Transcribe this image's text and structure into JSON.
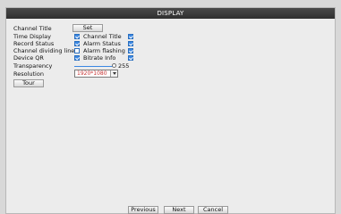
{
  "window": {
    "title": "DISPLAY"
  },
  "settings": {
    "channel_title": {
      "label": "Channel Title",
      "button": "Set"
    },
    "left_checks": [
      {
        "label": "Time Display",
        "checked": true
      },
      {
        "label": "Record Status",
        "checked": true
      },
      {
        "label": "Channel dividing line",
        "checked": false
      },
      {
        "label": "Device QR",
        "checked": true
      }
    ],
    "right_checks": [
      {
        "label": "Channel Title",
        "checked": true
      },
      {
        "label": "Alarm Status",
        "checked": true
      },
      {
        "label": "Alarm flashing",
        "checked": true
      },
      {
        "label": "Bitrate Info",
        "checked": true
      }
    ],
    "transparency": {
      "label": "Transparency",
      "value": "255",
      "level": 1.0
    },
    "resolution": {
      "label": "Resolution",
      "value": "1920*1080"
    },
    "tour": {
      "label": "Tour"
    }
  },
  "footer": {
    "previous": "Previous",
    "next": "Next",
    "cancel": "Cancel"
  },
  "colors": {
    "accent": "#3b88e3",
    "titlebar": "#2f2f2f",
    "select_text": "#c63232"
  }
}
